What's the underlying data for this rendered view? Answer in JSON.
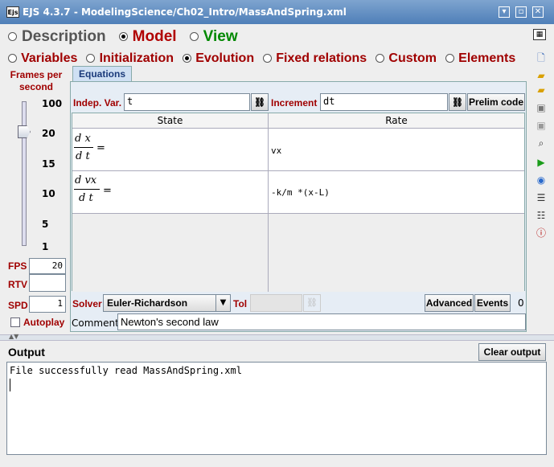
{
  "window": {
    "title": "EJS 4.3.7 - ModelingScience/Ch02_Intro/MassAndSpring.xml",
    "icon_text": "Ejs"
  },
  "main_tabs": [
    {
      "label": "Description",
      "selected": false
    },
    {
      "label": "Model",
      "selected": true
    },
    {
      "label": "View",
      "selected": false
    }
  ],
  "sub_tabs": [
    {
      "label": "Variables",
      "selected": false
    },
    {
      "label": "Initialization",
      "selected": false
    },
    {
      "label": "Evolution",
      "selected": true
    },
    {
      "label": "Fixed relations",
      "selected": false
    },
    {
      "label": "Custom",
      "selected": false
    },
    {
      "label": "Elements",
      "selected": false
    }
  ],
  "fps_panel": {
    "title": "Frames per second",
    "ticks": [
      "100",
      "20",
      "15",
      "10",
      "5",
      "1"
    ],
    "fps_label": "FPS",
    "fps_value": "20",
    "rtv_label": "RTV",
    "rtv_value": "",
    "spd_label": "SPD",
    "spd_value": "1",
    "autoplay_label": "Autoplay"
  },
  "equations_tab": "Equations",
  "indep_var": {
    "label": "Indep. Var.",
    "value": "t"
  },
  "increment": {
    "label": "Increment",
    "value": "dt"
  },
  "prelim_code_label": "Prelim code",
  "table": {
    "headers": [
      "State",
      "Rate"
    ],
    "rows": [
      {
        "num": "d x",
        "den": "d t",
        "eq": "=",
        "rate": "vx"
      },
      {
        "num": "d vx",
        "den": "d t",
        "eq": "=",
        "rate": "-k/m *(x-L)"
      }
    ]
  },
  "solver": {
    "label": "Solver",
    "value": "Euler-Richardson"
  },
  "tol_label": "Tol",
  "advanced_label": "Advanced",
  "events_label": "Events",
  "events_count": "0",
  "comment": {
    "label": "Comment",
    "value": "Newton's second law"
  },
  "output": {
    "title": "Output",
    "clear_label": "Clear output",
    "text": "File successfully read MassAndSpring.xml"
  },
  "colors": {
    "title_bar": "#4f7fb8",
    "model_tab": "#b00000",
    "view_tab": "#008800",
    "label_red": "#a00000"
  }
}
